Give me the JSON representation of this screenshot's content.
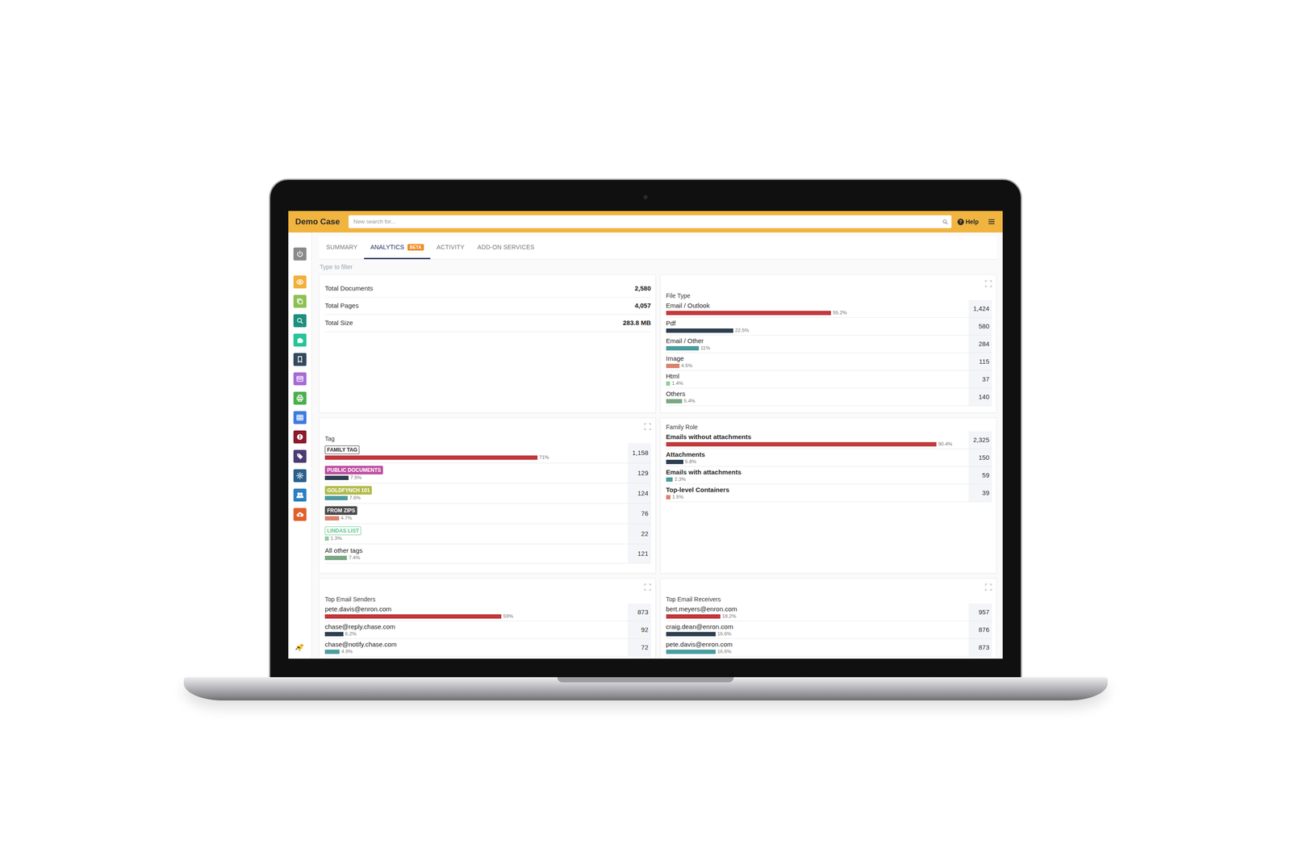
{
  "window": {
    "title": "Demo Case"
  },
  "search": {
    "placeholder": "New search for..."
  },
  "help": {
    "icon": "?",
    "label": "Help"
  },
  "sidebar": {
    "items": [
      {
        "color": "#8a8a8a"
      },
      {
        "color": "#f2b13c"
      },
      {
        "color": "#8dc153"
      },
      {
        "color": "#1e8f7e"
      },
      {
        "color": "#27c49a"
      },
      {
        "color": "#34495e"
      },
      {
        "color": "#a66bd6"
      },
      {
        "color": "#4caf50"
      },
      {
        "color": "#3d7be0"
      },
      {
        "color": "#8b1a2c"
      },
      {
        "color": "#4b3b73"
      },
      {
        "color": "#2b5f8a"
      },
      {
        "color": "#2c7fc0"
      },
      {
        "color": "#e0612b"
      }
    ]
  },
  "tabs": [
    {
      "label": "SUMMARY",
      "selected": false
    },
    {
      "label": "ANALYTICS",
      "selected": true,
      "badge": "BETA"
    },
    {
      "label": "ACTIVITY",
      "selected": false
    },
    {
      "label": "ADD-ON SERVICES",
      "selected": false
    }
  ],
  "filter": {
    "placeholder": "Type to filter"
  },
  "cards": [
    {
      "kind": "stats",
      "expandable": false,
      "rows": [
        {
          "label": "Total Documents",
          "value": "2,580"
        },
        {
          "label": "Total Pages",
          "value": "4,057"
        },
        {
          "label": "Total Size",
          "value": "283.8 MB"
        }
      ]
    },
    {
      "kind": "bars",
      "title": "File Type",
      "expandable": true,
      "bold_labels": false,
      "rows": [
        {
          "kind": "text",
          "label": "Email / Outlook",
          "percent": "55.2%",
          "level": 0.552,
          "count": "1,424",
          "color": "#c0393d"
        },
        {
          "kind": "text",
          "label": "Pdf",
          "percent": "22.5%",
          "level": 0.225,
          "count": "580",
          "color": "#2c3e50"
        },
        {
          "kind": "text",
          "label": "Email / Other",
          "percent": "11%",
          "level": 0.11,
          "count": "284",
          "color": "#4c9ca0"
        },
        {
          "kind": "text",
          "label": "Image",
          "percent": "4.5%",
          "level": 0.045,
          "count": "115",
          "color": "#d9826c"
        },
        {
          "kind": "text",
          "label": "Html",
          "percent": "1.4%",
          "level": 0.014,
          "count": "37",
          "color": "#8fce9f"
        },
        {
          "kind": "text",
          "label": "Others",
          "percent": "5.4%",
          "level": 0.054,
          "count": "140",
          "color": "#79a883"
        }
      ]
    },
    {
      "kind": "bars",
      "title": "Tag",
      "expandable": true,
      "bold_labels": false,
      "rows": [
        {
          "kind": "outline-tag",
          "label": "FAMILY TAG",
          "tag_color": "#333333",
          "percent": "71%",
          "level": 0.71,
          "count": "1,158",
          "color": "#c0393d"
        },
        {
          "kind": "solid-tag",
          "label": "PUBLIC DOCUMENTS",
          "tag_color": "#c04fa3",
          "percent": "7.9%",
          "level": 0.079,
          "count": "129",
          "color": "#2c3e50"
        },
        {
          "kind": "solid-tag",
          "label": "GOLDFYNCH 101",
          "tag_color": "#b3bb4a",
          "percent": "7.6%",
          "level": 0.076,
          "count": "124",
          "color": "#4c9ca0"
        },
        {
          "kind": "solid-tag",
          "label": "FROM ZIPS",
          "tag_color": "#4a4a4a",
          "percent": "4.7%",
          "level": 0.047,
          "count": "76",
          "color": "#d9826c"
        },
        {
          "kind": "outline-tag",
          "label": "LINDAS LIST",
          "tag_color": "#5fc48f",
          "percent": "1.3%",
          "level": 0.013,
          "count": "22",
          "color": "#8fce9f"
        },
        {
          "kind": "text",
          "label": "All other tags",
          "percent": "7.4%",
          "level": 0.074,
          "count": "121",
          "color": "#79a883"
        }
      ]
    },
    {
      "kind": "bars",
      "title": "Family Role",
      "expandable": false,
      "bold_labels": true,
      "rows": [
        {
          "kind": "text",
          "label": "Emails without attachments",
          "percent": "90.4%",
          "level": 0.904,
          "count": "2,325",
          "color": "#c0393d"
        },
        {
          "kind": "text",
          "label": "Attachments",
          "percent": "5.8%",
          "level": 0.058,
          "count": "150",
          "color": "#2c3e50"
        },
        {
          "kind": "text",
          "label": "Emails with attachments",
          "percent": "2.3%",
          "level": 0.023,
          "count": "59",
          "color": "#4c9ca0"
        },
        {
          "kind": "text",
          "label": "Top-level Containers",
          "percent": "1.5%",
          "level": 0.015,
          "count": "39",
          "color": "#d9826c"
        }
      ]
    },
    {
      "kind": "bars",
      "title": "Top Email Senders",
      "expandable": true,
      "bold_labels": false,
      "rows": [
        {
          "kind": "text",
          "label": "pete.davis@enron.com",
          "percent": "59%",
          "level": 0.59,
          "count": "873",
          "color": "#c0393d"
        },
        {
          "kind": "text",
          "label": "chase@reply.chase.com",
          "percent": "6.2%",
          "level": 0.062,
          "count": "92",
          "color": "#2c3e50"
        },
        {
          "kind": "text",
          "label": "chase@notify.chase.com",
          "percent": "4.9%",
          "level": 0.049,
          "count": "72",
          "color": "#4c9ca0"
        }
      ]
    },
    {
      "kind": "bars",
      "title": "Top Email Receivers",
      "expandable": true,
      "bold_labels": false,
      "rows": [
        {
          "kind": "text",
          "label": "bert.meyers@enron.com",
          "percent": "18.2%",
          "level": 0.182,
          "count": "957",
          "color": "#c0393d"
        },
        {
          "kind": "text",
          "label": "craig.dean@enron.com",
          "percent": "16.6%",
          "level": 0.166,
          "count": "876",
          "color": "#2c3e50"
        },
        {
          "kind": "text",
          "label": "pete.davis@enron.com",
          "percent": "16.6%",
          "level": 0.166,
          "count": "873",
          "color": "#4c9ca0"
        }
      ]
    }
  ]
}
